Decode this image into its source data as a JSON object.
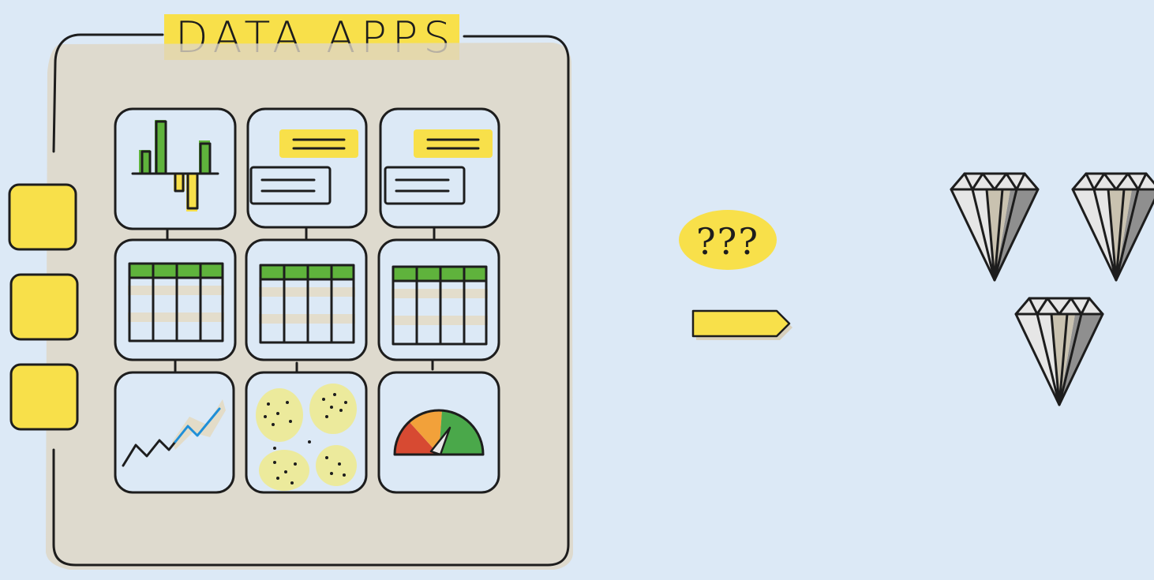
{
  "title": "DATA APPS",
  "question_badge": "???",
  "colors": {
    "background": "#dce9f6",
    "highlight_yellow": "#f8e04a",
    "bar_green": "#5fb33c",
    "ink": "#1d1d1d",
    "shadow": "#ded6c4",
    "dot_blob": "#ecea9c",
    "line_blue": "#1f8fd8",
    "gauge_red": "#d74a32",
    "gauge_orange": "#f2a13a",
    "gauge_green": "#4aa84a",
    "gem_light": "#e8e8e8",
    "gem_dark": "#8f8f8f"
  },
  "side_tabs": [
    "yellow-tab",
    "yellow-tab",
    "yellow-tab"
  ],
  "tiles": [
    {
      "icon": "bar-chart-icon"
    },
    {
      "icon": "text-card-icon"
    },
    {
      "icon": "text-card-icon"
    },
    {
      "icon": "table-icon"
    },
    {
      "icon": "table-icon"
    },
    {
      "icon": "table-icon"
    },
    {
      "icon": "line-chart-icon"
    },
    {
      "icon": "scatter-blobs-icon"
    },
    {
      "icon": "gauge-icon"
    }
  ],
  "outputs": [
    {
      "icon": "diamond-icon"
    },
    {
      "icon": "diamond-icon"
    },
    {
      "icon": "diamond-icon"
    }
  ]
}
